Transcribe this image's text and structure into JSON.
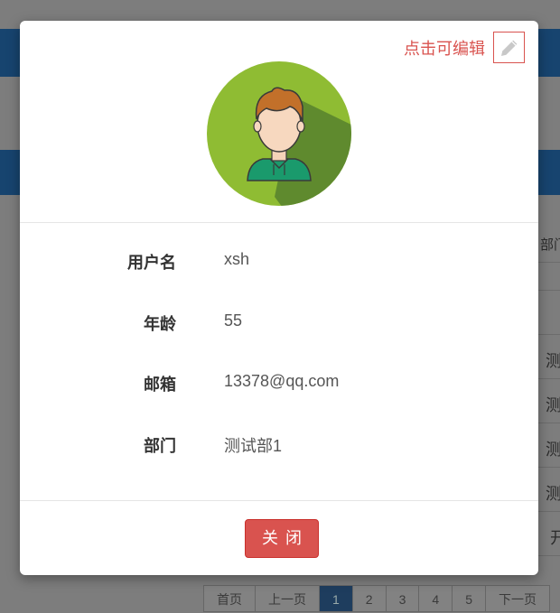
{
  "background": {
    "table_header_partial": "部门",
    "column_cells": [
      "测",
      "测",
      "测",
      "测",
      "开"
    ],
    "pagination": [
      "首页",
      "上一页",
      "1",
      "2",
      "3",
      "4",
      "5",
      "下一页"
    ]
  },
  "modal": {
    "edit_hint": "点击可编辑",
    "edit_icon": "pencil-icon",
    "avatar_icon": "user-avatar-icon",
    "fields": [
      {
        "label": "用户名",
        "value": "xsh"
      },
      {
        "label": "年龄",
        "value": "55"
      },
      {
        "label": "邮箱",
        "value": "13378@qq.com"
      },
      {
        "label": "部门",
        "value": "测试部1"
      }
    ],
    "close_label": "关闭"
  },
  "colors": {
    "danger": "#d9534f",
    "avatar_green": "#8fbc33",
    "header_bar": "#17446f"
  }
}
